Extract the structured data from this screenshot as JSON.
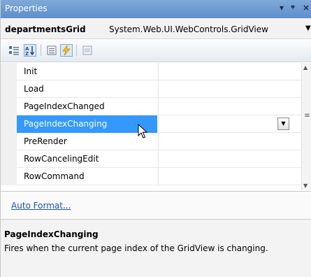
{
  "window": {
    "title": "Properties",
    "pin_glyph": "▾ ᵠ",
    "close_glyph": "×"
  },
  "object_selector": {
    "name": "departmentsGrid",
    "type": "System.Web.UI.WebControls.GridView"
  },
  "toolbar": {
    "buttons": [
      "categorized-icon",
      "alphabetical-icon",
      "properties-icon",
      "events-icon",
      "property-pages-icon"
    ],
    "active": "events-icon"
  },
  "grid": {
    "rows": [
      {
        "name": "Init",
        "value": ""
      },
      {
        "name": "Load",
        "value": ""
      },
      {
        "name": "PageIndexChanged",
        "value": ""
      },
      {
        "name": "PageIndexChanging",
        "value": "",
        "selected": true
      },
      {
        "name": "PreRender",
        "value": ""
      },
      {
        "name": "RowCancelingEdit",
        "value": ""
      },
      {
        "name": "RowCommand",
        "value": ""
      }
    ]
  },
  "commands": {
    "auto_format_label": "Auto Format..."
  },
  "description": {
    "title": "PageIndexChanging",
    "text": "Fires when the current page index of the GridView is changing."
  },
  "colors": {
    "selection": "#3399ff",
    "link": "#1a52b8",
    "titlebar": "#5d8fcb"
  }
}
